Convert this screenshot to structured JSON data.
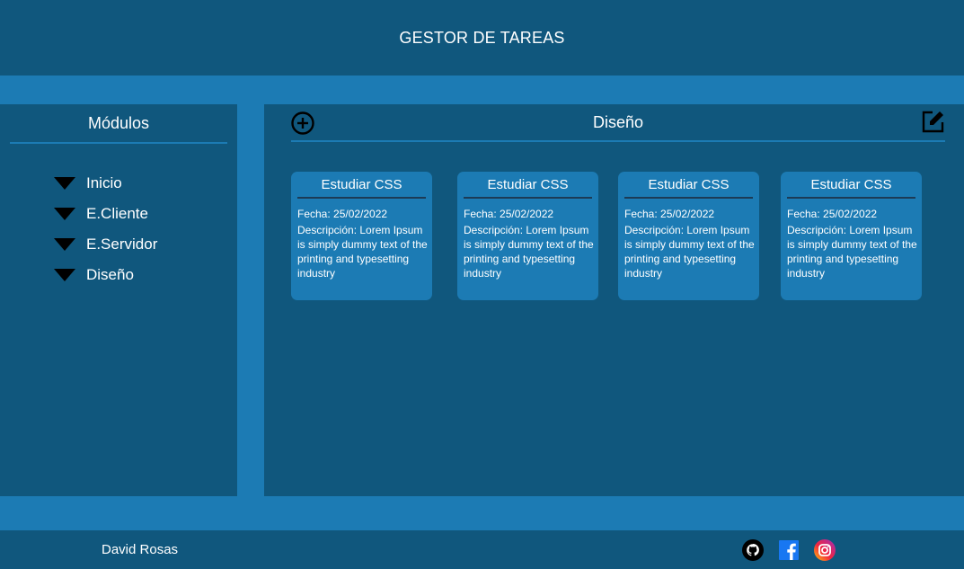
{
  "header": {
    "title": "GESTOR DE TAREAS"
  },
  "sidebar": {
    "title": "Módulos",
    "items": [
      {
        "label": "Inicio",
        "icon": "triangle-down-icon"
      },
      {
        "label": "E.Cliente",
        "icon": "triangle-down-icon"
      },
      {
        "label": "E.Servidor",
        "icon": "triangle-down-icon"
      },
      {
        "label": "Diseño",
        "icon": "triangle-down-icon"
      }
    ]
  },
  "main": {
    "title": "Diseño",
    "add_icon": "plus-circle-icon",
    "edit_icon": "edit-icon",
    "cards": [
      {
        "title": "Estudiar CSS",
        "date": "Fecha: 25/02/2022",
        "description": "Descripción: Lorem Ipsum is simply dummy text of the printing and typesetting industry"
      },
      {
        "title": "Estudiar CSS",
        "date": "Fecha: 25/02/2022",
        "description": "Descripción: Lorem Ipsum is simply dummy text of the printing and typesetting industry"
      },
      {
        "title": "Estudiar CSS",
        "date": "Fecha: 25/02/2022",
        "description": "Descripción: Lorem Ipsum is simply dummy text of the printing and typesetting industry"
      },
      {
        "title": "Estudiar CSS",
        "date": "Fecha: 25/02/2022",
        "description": "Descripción: Lorem Ipsum is simply dummy text of the printing and typesetting industry"
      }
    ]
  },
  "footer": {
    "author": "David Rosas",
    "social": [
      "github-icon",
      "facebook-icon",
      "instagram-icon"
    ]
  },
  "colors": {
    "dark_blue": "#10577d",
    "light_blue": "#1c7bb4",
    "facebook": "#1877f2"
  }
}
